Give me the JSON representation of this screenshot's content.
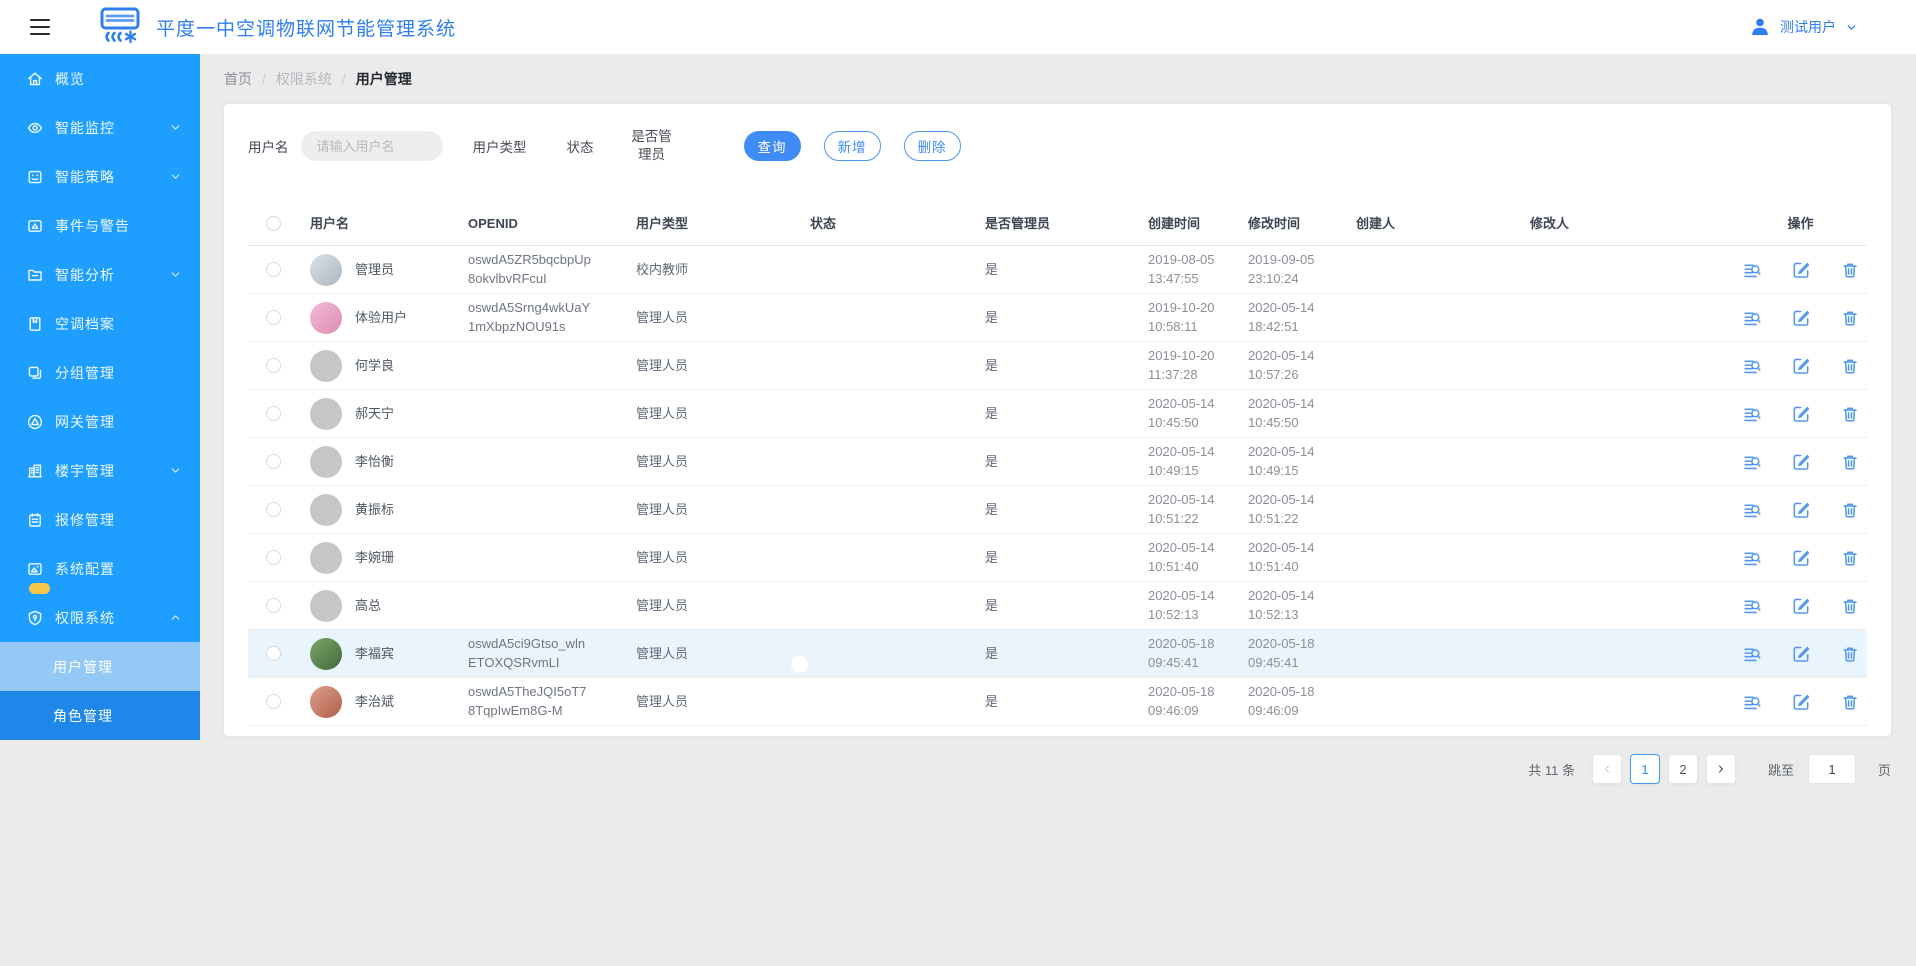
{
  "header": {
    "title": "平度一中空调物联网节能管理系统",
    "user_name": "测试用户"
  },
  "sidebar": {
    "items": [
      {
        "label": "概览",
        "icon": "home"
      },
      {
        "label": "智能监控",
        "icon": "monitor",
        "chevron": "down"
      },
      {
        "label": "智能策略",
        "icon": "strategy",
        "chevron": "down"
      },
      {
        "label": "事件与警告",
        "icon": "event"
      },
      {
        "label": "智能分析",
        "icon": "analysis",
        "chevron": "down"
      },
      {
        "label": "空调档案",
        "icon": "archive"
      },
      {
        "label": "分组管理",
        "icon": "group"
      },
      {
        "label": "网关管理",
        "icon": "gateway"
      },
      {
        "label": "楼宇管理",
        "icon": "building",
        "chevron": "down"
      },
      {
        "label": "报修管理",
        "icon": "repair"
      },
      {
        "label": "系统配置",
        "icon": "config",
        "badge": true
      },
      {
        "label": "权限系统",
        "icon": "permission",
        "chevron": "up",
        "expanded": true
      }
    ],
    "submenu": [
      {
        "label": "用户管理",
        "active": true
      },
      {
        "label": "角色管理",
        "active": false
      }
    ]
  },
  "breadcrumb": {
    "items": [
      "首页",
      "权限系统",
      "用户管理"
    ]
  },
  "filters": {
    "username_label": "用户名",
    "username_placeholder": "请输入用户名",
    "username_value": "",
    "usertype_label": "用户类型",
    "status_label": "状态",
    "admin_label": "是否管理员"
  },
  "toolbar": {
    "query_label": "查询",
    "add_label": "新增",
    "delete_label": "删除"
  },
  "table": {
    "columns": [
      "用户名",
      "OPENID",
      "用户类型",
      "状态",
      "是否管理员",
      "创建时间",
      "修改时间",
      "创建人",
      "修改人",
      "操作"
    ],
    "rows": [
      {
        "name": "管理员",
        "openid": "oswdA5ZR5bqcbpUp8okvlbvRFcuI",
        "user_type": "校内教师",
        "status_on": true,
        "is_admin": "是",
        "created": "2019-08-05 13:47:55",
        "modified": "2019-09-05 23:10:24",
        "creator": "",
        "modifier": "",
        "avatar": {
          "kind": "photo",
          "colors": [
            "#dde3e7",
            "#a9b6bf"
          ]
        },
        "highlighted": false
      },
      {
        "name": "体验用户",
        "openid": "oswdA5Srng4wkUaY1mXbpzNOU91s",
        "user_type": "管理人员",
        "status_on": true,
        "is_admin": "是",
        "created": "2019-10-20 10:58:11",
        "modified": "2020-05-14 18:42:51",
        "creator": "",
        "modifier": "",
        "avatar": {
          "kind": "photo",
          "colors": [
            "#f3bcd4",
            "#db8cb4"
          ]
        },
        "highlighted": false
      },
      {
        "name": "何学良",
        "openid": "",
        "user_type": "管理人员",
        "status_on": true,
        "is_admin": "是",
        "created": "2019-10-20 11:37:28",
        "modified": "2020-05-14 10:57:26",
        "creator": "",
        "modifier": "",
        "avatar": {
          "kind": "placeholder"
        },
        "highlighted": false
      },
      {
        "name": "郝天宁",
        "openid": "",
        "user_type": "管理人员",
        "status_on": true,
        "is_admin": "是",
        "created": "2020-05-14 10:45:50",
        "modified": "2020-05-14 10:45:50",
        "creator": "",
        "modifier": "",
        "avatar": {
          "kind": "placeholder"
        },
        "highlighted": false
      },
      {
        "name": "李怡衡",
        "openid": "",
        "user_type": "管理人员",
        "status_on": true,
        "is_admin": "是",
        "created": "2020-05-14 10:49:15",
        "modified": "2020-05-14 10:49:15",
        "creator": "",
        "modifier": "",
        "avatar": {
          "kind": "placeholder"
        },
        "highlighted": false
      },
      {
        "name": "黄振标",
        "openid": "",
        "user_type": "管理人员",
        "status_on": true,
        "is_admin": "是",
        "created": "2020-05-14 10:51:22",
        "modified": "2020-05-14 10:51:22",
        "creator": "",
        "modifier": "",
        "avatar": {
          "kind": "placeholder"
        },
        "highlighted": false
      },
      {
        "name": "李婉珊",
        "openid": "",
        "user_type": "管理人员",
        "status_on": true,
        "is_admin": "是",
        "created": "2020-05-14 10:51:40",
        "modified": "2020-05-14 10:51:40",
        "creator": "",
        "modifier": "",
        "avatar": {
          "kind": "placeholder"
        },
        "highlighted": false
      },
      {
        "name": "高总",
        "openid": "",
        "user_type": "管理人员",
        "status_on": true,
        "is_admin": "是",
        "created": "2020-05-14 10:52:13",
        "modified": "2020-05-14 10:52:13",
        "creator": "",
        "modifier": "",
        "avatar": {
          "kind": "placeholder"
        },
        "highlighted": false
      },
      {
        "name": "李福宾",
        "openid": "oswdA5ci9Gtso_wlnETOXQSRvmLI",
        "user_type": "管理人员",
        "status_on": true,
        "is_admin": "是",
        "created": "2020-05-18 09:45:41",
        "modified": "2020-05-18 09:45:41",
        "creator": "",
        "modifier": "",
        "avatar": {
          "kind": "photo",
          "colors": [
            "#7da868",
            "#41663a"
          ]
        },
        "highlighted": true
      },
      {
        "name": "李治斌",
        "openid": "oswdA5TheJQI5oT78TqpIwEm8G-M",
        "user_type": "管理人员",
        "status_on": true,
        "is_admin": "是",
        "created": "2020-05-18 09:46:09",
        "modified": "2020-05-18 09:46:09",
        "creator": "",
        "modifier": "",
        "avatar": {
          "kind": "photo",
          "colors": [
            "#dca08b",
            "#b05f4a"
          ]
        },
        "highlighted": false
      }
    ]
  },
  "pagination": {
    "total_label": "共 11 条",
    "pages": [
      "1",
      "2"
    ],
    "current_page": "1",
    "jump_label": "跳至",
    "jump_value": "1",
    "page_unit": "页"
  },
  "colors": {
    "sidebar_blue": "#1e9fff",
    "submenu_active": "#93c9f4",
    "submenu_bg": "#1e87e9",
    "primary_blue": "#3f8cf6",
    "toggle_on": "#1890ff",
    "title_blue": "#2e7ef0",
    "badge_yellow": "#f7c54a",
    "row_highlight": "#e9f4fd"
  }
}
